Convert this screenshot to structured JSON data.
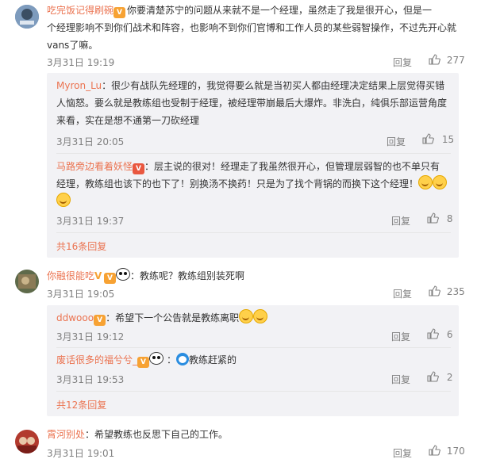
{
  "comments": [
    {
      "user": "吃完饭记得刷碗",
      "text_lines": [
        "你要清楚苏宁的问题从来就不是一个经理，虽然走了我是很开心，但是一",
        "个经理影响不到你们战术和阵容，也影响不到你们官博和工作人员的某些弱智操作，不过先开心就",
        "vans了嘛。"
      ],
      "time": "3月31日 19:19",
      "reply_label": "回复",
      "likes": "277",
      "replies": [
        {
          "user": "Myron_Lu",
          "text_lines": [
            "：很少有战队先经理的，我觉得要么就是当初买人都由经理决定结果上层觉得买错",
            "人恼怒。要么就是教练组也受制于经理，被经理带崩最后大爆炸。非洗白，纯俱乐部运营角度",
            "来看，实在是想不通第一刀砍经理"
          ],
          "time": "3月31日 20:05",
          "reply_label": "回复",
          "likes": "15"
        },
        {
          "user": "马路旁边看着妖怪",
          "text_lines": [
            "：层主说的很对！经理走了我虽然很开心，但管理层弱智的也不单只有",
            "经理，教练组也该下的也下了！别换汤不换药！只是为了找个背锅的而换下这个经理！"
          ],
          "time": "3月31日 19:37",
          "reply_label": "回复",
          "likes": "8"
        }
      ],
      "more_label": "共16条回复"
    },
    {
      "user": "你融很能吃",
      "text": "：教练呢？教练组别装死啊",
      "time": "3月31日 19:05",
      "reply_label": "回复",
      "likes": "235",
      "replies": [
        {
          "user": "ddwooo",
          "text": "：希望下一个公告就是教练离职",
          "time": "3月31日 19:12",
          "reply_label": "回复",
          "likes": "6"
        },
        {
          "user": "废话很多的福兮兮_",
          "text": "教练赶紧的",
          "time": "3月31日 19:53",
          "reply_label": "回复",
          "likes": "2"
        }
      ],
      "more_label": "共12条回复"
    },
    {
      "user": "霄河别处",
      "text": "：希望教练也反思下自己的工作。",
      "time": "3月31日 19:01",
      "reply_label": "回复",
      "likes": "170"
    }
  ],
  "colors": {
    "nick": "#eb7350",
    "meta": "#808080",
    "reply_bg": "#f2f2f5"
  }
}
